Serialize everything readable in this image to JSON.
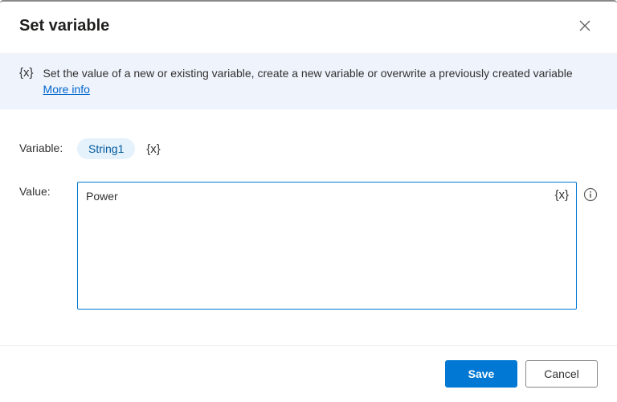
{
  "header": {
    "title": "Set variable"
  },
  "banner": {
    "text": "Set the value of a new or existing variable, create a new variable or overwrite a previously created variable ",
    "link_label": "More info"
  },
  "form": {
    "variable_label": "Variable:",
    "variable_chip": "String1",
    "value_label": "Value:",
    "value_content": "Power"
  },
  "footer": {
    "save_label": "Save",
    "cancel_label": "Cancel"
  },
  "icons": {
    "var_token": "{x}"
  }
}
